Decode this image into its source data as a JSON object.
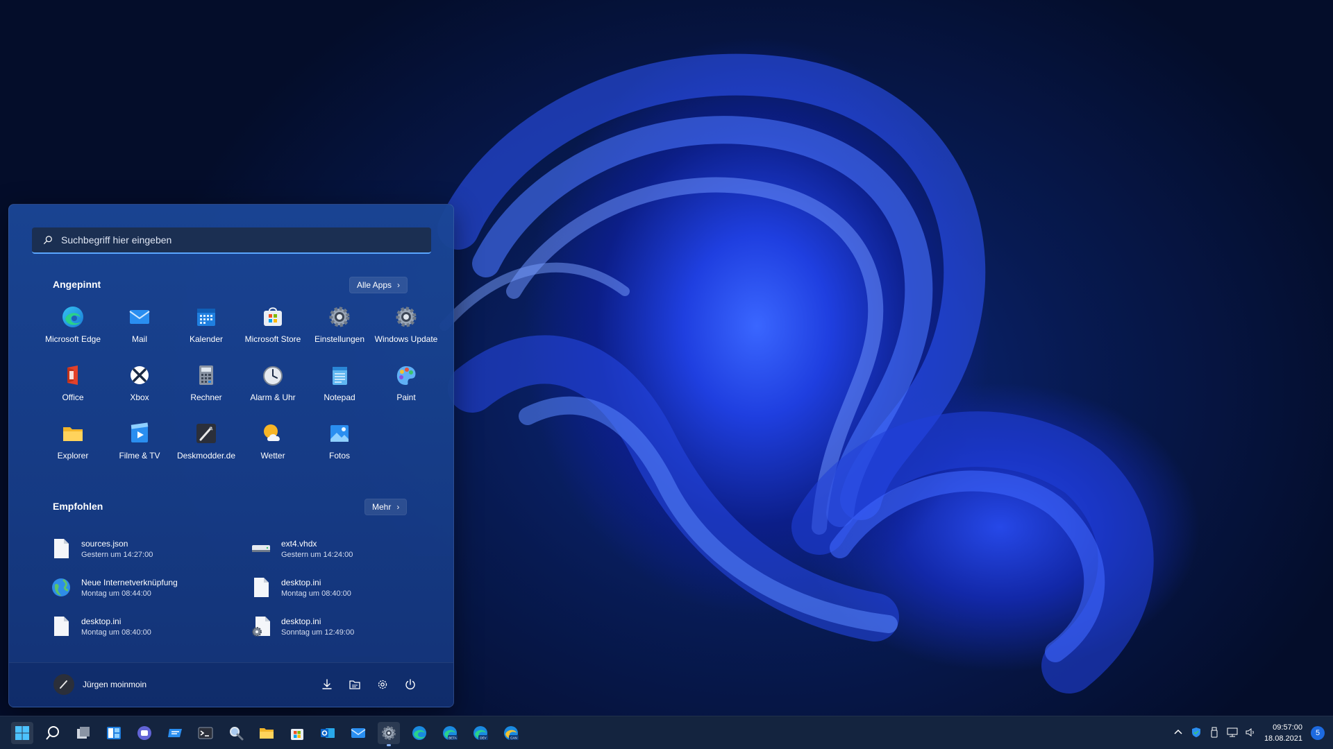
{
  "search": {
    "placeholder": "Suchbegriff hier eingeben"
  },
  "pinned": {
    "title": "Angepinnt",
    "all_apps_label": "Alle Apps",
    "apps": [
      {
        "label": "Microsoft Edge",
        "icon": "edge-icon"
      },
      {
        "label": "Mail",
        "icon": "mail-icon"
      },
      {
        "label": "Kalender",
        "icon": "calendar-icon"
      },
      {
        "label": "Microsoft Store",
        "icon": "store-icon"
      },
      {
        "label": "Einstellungen",
        "icon": "settings-gear-icon"
      },
      {
        "label": "Windows Update",
        "icon": "settings-gear-icon"
      },
      {
        "label": "Office",
        "icon": "office-icon"
      },
      {
        "label": "Xbox",
        "icon": "xbox-icon"
      },
      {
        "label": "Rechner",
        "icon": "calculator-icon"
      },
      {
        "label": "Alarm & Uhr",
        "icon": "clock-icon"
      },
      {
        "label": "Notepad",
        "icon": "notepad-icon"
      },
      {
        "label": "Paint",
        "icon": "paint-palette-icon"
      },
      {
        "label": "Explorer",
        "icon": "folder-icon"
      },
      {
        "label": "Filme & TV",
        "icon": "film-play-icon"
      },
      {
        "label": "Deskmodder.de",
        "icon": "deskmodder-icon"
      },
      {
        "label": "Wetter",
        "icon": "weather-icon"
      },
      {
        "label": "Fotos",
        "icon": "photos-icon"
      }
    ]
  },
  "recommended": {
    "title": "Empfohlen",
    "more_label": "Mehr",
    "items": [
      {
        "name": "sources.json",
        "time": "Gestern um 14:27:00",
        "icon": "file-icon"
      },
      {
        "name": "ext4.vhdx",
        "time": "Gestern um 14:24:00",
        "icon": "drive-icon"
      },
      {
        "name": "Neue Internetverknüpfung",
        "time": "Montag um 08:44:00",
        "icon": "globe-icon"
      },
      {
        "name": "desktop.ini",
        "time": "Montag um 08:40:00",
        "icon": "file-icon"
      },
      {
        "name": "desktop.ini",
        "time": "Montag um 08:40:00",
        "icon": "file-icon"
      },
      {
        "name": "desktop.ini",
        "time": "Sonntag um 12:49:00",
        "icon": "file-settings-icon"
      }
    ]
  },
  "footer": {
    "user_name": "Jürgen moinmoin"
  },
  "taskbar": {
    "icons": [
      "windows-start-icon",
      "search-icon",
      "task-view-icon",
      "widgets-icon",
      "teams-chat-icon",
      "feedback-icon",
      "terminal-icon",
      "magnifier-icon",
      "file-explorer-icon",
      "store-icon",
      "outlook-icon",
      "mail-icon",
      "settings-gear-icon",
      "edge-icon",
      "edge-beta-icon",
      "edge-dev-icon",
      "edge-canary-icon"
    ],
    "edge_badges": {
      "beta": "BETA",
      "dev": "DEV",
      "canary": "CAN"
    }
  },
  "tray": {
    "time": "09:57:00",
    "date": "18.08.2021",
    "notifications": "5"
  },
  "colors": {
    "accent": "#5aa6ff",
    "panel": "#1a4696",
    "taskbar": "#14243f"
  }
}
